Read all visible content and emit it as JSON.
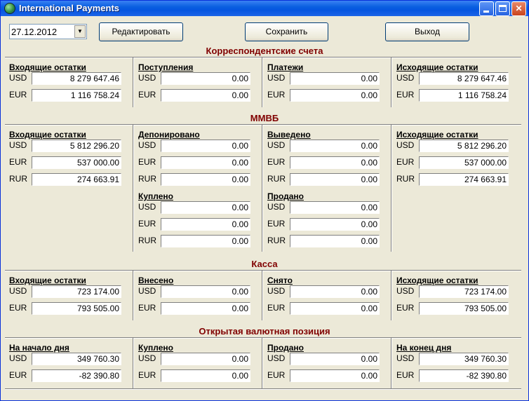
{
  "window": {
    "title": "International Payments"
  },
  "toolbar": {
    "date": "27.12.2012",
    "edit_label": "Редактировать",
    "save_label": "Сохранить",
    "exit_label": "Выход"
  },
  "sections": {
    "corr": {
      "title": "Корреспондентские счета",
      "opening": {
        "label": "Входящие остатки",
        "rows": [
          {
            "cur": "USD",
            "val": "8 279 647.46"
          },
          {
            "cur": "EUR",
            "val": "1 116 758.24"
          }
        ]
      },
      "receipts": {
        "label": "Поступления",
        "rows": [
          {
            "cur": "USD",
            "val": "0.00"
          },
          {
            "cur": "EUR",
            "val": "0.00"
          }
        ]
      },
      "payments": {
        "label": "Платежи",
        "rows": [
          {
            "cur": "USD",
            "val": "0.00"
          },
          {
            "cur": "EUR",
            "val": "0.00"
          }
        ]
      },
      "closing": {
        "label": "Исходящие остатки",
        "rows": [
          {
            "cur": "USD",
            "val": "8 279 647.46"
          },
          {
            "cur": "EUR",
            "val": "1 116 758.24"
          }
        ]
      }
    },
    "micex": {
      "title": "ММВБ",
      "opening": {
        "label": "Входящие остатки",
        "rows": [
          {
            "cur": "USD",
            "val": "5 812 296.20"
          },
          {
            "cur": "EUR",
            "val": "537 000.00"
          },
          {
            "cur": "RUR",
            "val": "274 663.91"
          }
        ]
      },
      "deposited": {
        "label": "Депонировано",
        "rows": [
          {
            "cur": "USD",
            "val": "0.00"
          },
          {
            "cur": "EUR",
            "val": "0.00"
          },
          {
            "cur": "RUR",
            "val": "0.00"
          }
        ]
      },
      "withdrawn": {
        "label": "Выведено",
        "rows": [
          {
            "cur": "USD",
            "val": "0.00"
          },
          {
            "cur": "EUR",
            "val": "0.00"
          },
          {
            "cur": "RUR",
            "val": "0.00"
          }
        ]
      },
      "bought": {
        "label": "Куплено",
        "rows": [
          {
            "cur": "USD",
            "val": "0.00"
          },
          {
            "cur": "EUR",
            "val": "0.00"
          },
          {
            "cur": "RUR",
            "val": "0.00"
          }
        ]
      },
      "sold": {
        "label": "Продано",
        "rows": [
          {
            "cur": "USD",
            "val": "0.00"
          },
          {
            "cur": "EUR",
            "val": "0.00"
          },
          {
            "cur": "RUR",
            "val": "0.00"
          }
        ]
      },
      "closing": {
        "label": "Исходящие остатки",
        "rows": [
          {
            "cur": "USD",
            "val": "5 812 296.20"
          },
          {
            "cur": "EUR",
            "val": "537 000.00"
          },
          {
            "cur": "RUR",
            "val": "274 663.91"
          }
        ]
      }
    },
    "cash": {
      "title": "Касса",
      "opening": {
        "label": "Входящие остатки",
        "rows": [
          {
            "cur": "USD",
            "val": "723 174.00"
          },
          {
            "cur": "EUR",
            "val": "793 505.00"
          }
        ]
      },
      "deposited": {
        "label": "Внесено",
        "rows": [
          {
            "cur": "USD",
            "val": "0.00"
          },
          {
            "cur": "EUR",
            "val": "0.00"
          }
        ]
      },
      "withdrawn": {
        "label": "Снято",
        "rows": [
          {
            "cur": "USD",
            "val": "0.00"
          },
          {
            "cur": "EUR",
            "val": "0.00"
          }
        ]
      },
      "closing": {
        "label": "Исходящие остатки",
        "rows": [
          {
            "cur": "USD",
            "val": "723 174.00"
          },
          {
            "cur": "EUR",
            "val": "793 505.00"
          }
        ]
      }
    },
    "position": {
      "title": "Открытая валютная позиция",
      "start": {
        "label": "На начало дня",
        "rows": [
          {
            "cur": "USD",
            "val": "349 760.30"
          },
          {
            "cur": "EUR",
            "val": "-82 390.80"
          }
        ]
      },
      "bought": {
        "label": "Куплено",
        "rows": [
          {
            "cur": "USD",
            "val": "0.00"
          },
          {
            "cur": "EUR",
            "val": "0.00"
          }
        ]
      },
      "sold": {
        "label": "Продано",
        "rows": [
          {
            "cur": "USD",
            "val": "0.00"
          },
          {
            "cur": "EUR",
            "val": "0.00"
          }
        ]
      },
      "end": {
        "label": "На конец дня",
        "rows": [
          {
            "cur": "USD",
            "val": "349 760.30"
          },
          {
            "cur": "EUR",
            "val": "-82 390.80"
          }
        ]
      }
    }
  }
}
